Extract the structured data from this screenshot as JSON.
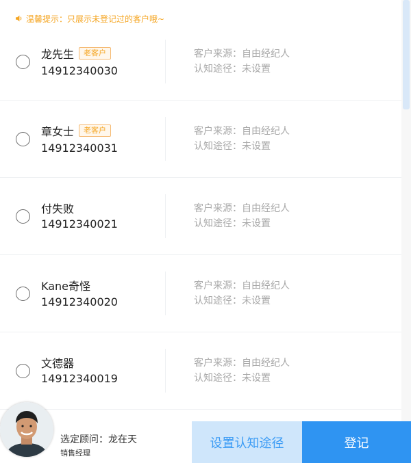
{
  "tip": {
    "text": "温馨提示：只展示未登记过的客户哦~",
    "icon": "speaker-icon",
    "color": "#f5a623"
  },
  "customers": [
    {
      "name": "龙先生",
      "badge": "老客户",
      "phone": "14912340030",
      "source_label": "客户来源：",
      "source": "自由经纪人",
      "channel_label": "认知途径：",
      "channel": "未设置"
    },
    {
      "name": "章女士",
      "badge": "老客户",
      "phone": "14912340031",
      "source_label": "客户来源：",
      "source": "自由经纪人",
      "channel_label": "认知途径：",
      "channel": "未设置"
    },
    {
      "name": "付失败",
      "badge": "",
      "phone": "14912340021",
      "source_label": "客户来源：",
      "source": "自由经纪人",
      "channel_label": "认知途径：",
      "channel": "未设置"
    },
    {
      "name": "Kane奇怪",
      "badge": "",
      "phone": "14912340020",
      "source_label": "客户来源：",
      "source": "自由经纪人",
      "channel_label": "认知途径：",
      "channel": "未设置"
    },
    {
      "name": "文德器",
      "badge": "",
      "phone": "14912340019",
      "source_label": "客户来源：",
      "source": "自由经纪人",
      "channel_label": "认知途径：",
      "channel": "未设置"
    }
  ],
  "advisor": {
    "label": "选定顾问：",
    "name": "龙在天",
    "role": "销售经理"
  },
  "buttons": {
    "set_channel": "设置认知途径",
    "register": "登记"
  },
  "colors": {
    "accent": "#2f94f2",
    "accent_light": "#cfe6fb",
    "badge": "#f5a623"
  }
}
